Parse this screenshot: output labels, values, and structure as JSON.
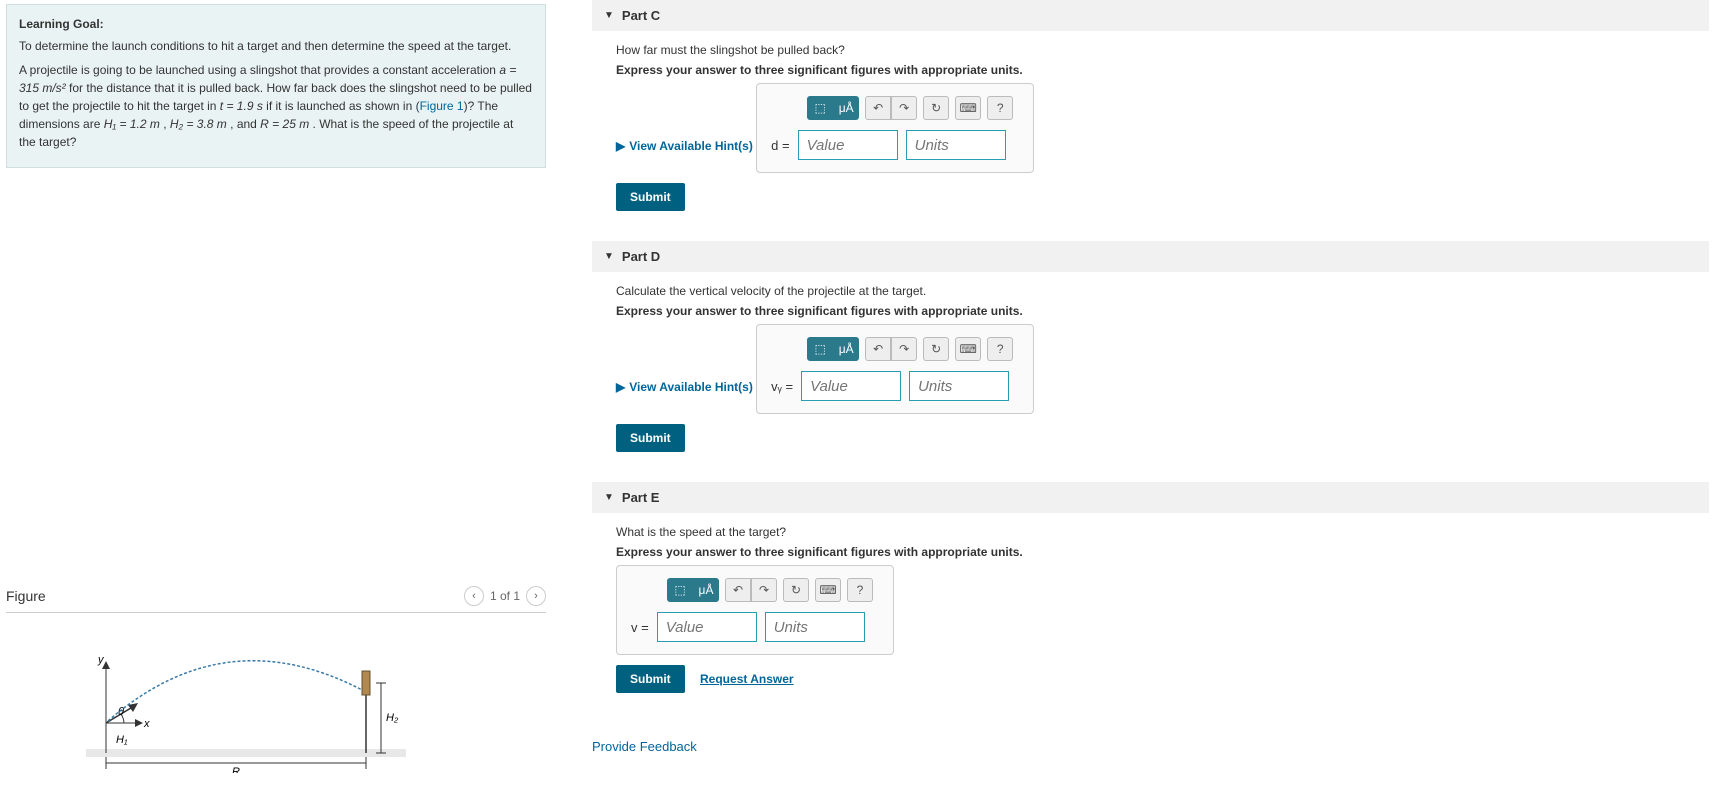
{
  "learning_goal": {
    "title": "Learning Goal:",
    "intro": "To determine the launch conditions to hit a target and then determine the speed at the target.",
    "p1_a": "A projectile is going to be launched using a slingshot that provides a constant acceleration ",
    "a_eq": "a = 315 m/s²",
    "p1_b": " for the distance that it is pulled back. How far back does the slingshot need to be pulled to get the projectile to hit the target in ",
    "t_eq": "t = 1.9 s",
    "p1_c": " if it is launched as shown in (",
    "fig_link": "Figure 1",
    "p1_d": ")? The dimensions are ",
    "h1": "H₁ = 1.2 m",
    "sep1": " , ",
    "h2": "H₂ = 3.8 m",
    "sep2": " , and ",
    "r": "R = 25 m",
    "p1_e": " . What is the speed of the projectile at the target?"
  },
  "figure": {
    "title": "Figure",
    "nav": "1 of 1",
    "labels": {
      "y": "y",
      "x": "x",
      "theta": "θ",
      "h1": "H₁",
      "h2": "H₂",
      "r": "R"
    }
  },
  "toolbar": {
    "templates": "⬚",
    "sigma": "μÅ",
    "undo": "↶",
    "redo": "↷",
    "reset": "↻",
    "keyboard": "⌨",
    "help": "?"
  },
  "common": {
    "value_ph": "Value",
    "units_ph": "Units",
    "submit": "Submit",
    "hints": "View Available Hint(s)",
    "instruct": "Express your answer to three significant figures with appropriate units.",
    "request": "Request Answer",
    "feedback": "Provide Feedback"
  },
  "parts": [
    {
      "title": "Part C",
      "question": "How far must the slingshot be pulled back?",
      "var": "d ="
    },
    {
      "title": "Part D",
      "question": "Calculate the vertical velocity of the projectile at the target.",
      "var": "vᵧ ="
    },
    {
      "title": "Part E",
      "question": "What is the speed at the target?",
      "var": "v ="
    }
  ]
}
